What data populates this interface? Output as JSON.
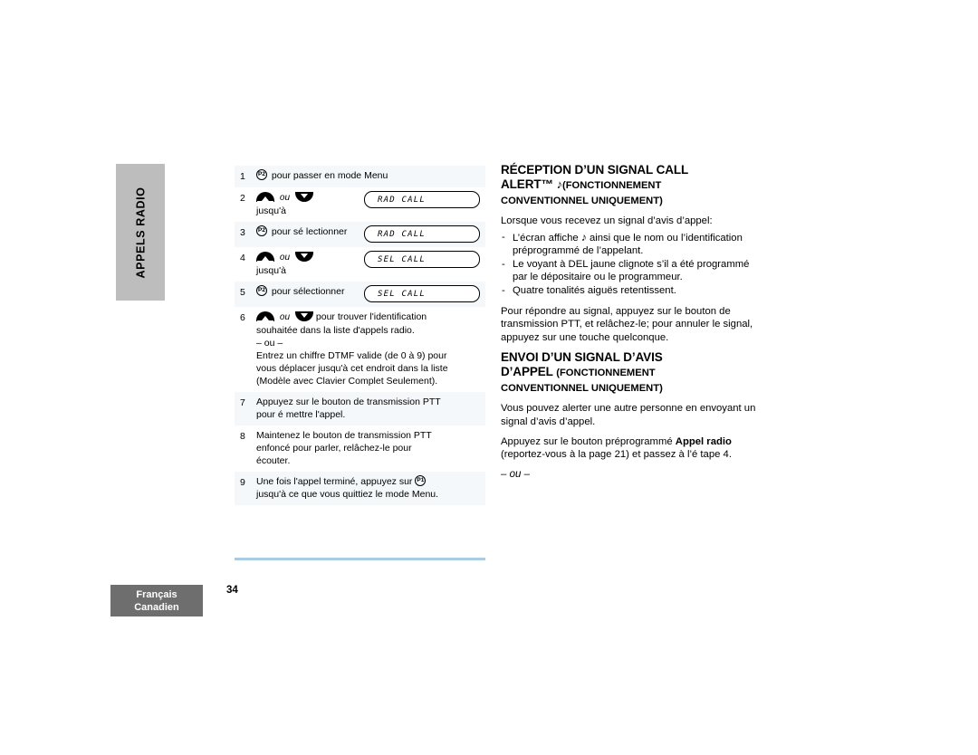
{
  "side_tab": {
    "label": "APPELS RADIO"
  },
  "steps": [
    {
      "num": "1",
      "shaded": true,
      "button": "P2",
      "text": "pour passer en mode Menu",
      "lcd": null,
      "layout": "inline"
    },
    {
      "num": "2",
      "shaded": false,
      "arrows": true,
      "ou": "ou",
      "text": "jusqu'à",
      "lcd": "RAD CALL",
      "layout": "arrows-lcd"
    },
    {
      "num": "3",
      "shaded": true,
      "button": "P2",
      "text": "pour sé lectionner",
      "lcd": "RAD CALL",
      "layout": "button-lcd"
    },
    {
      "num": "4",
      "shaded": false,
      "arrows": true,
      "ou": "ou",
      "text": "jusqu'à",
      "lcd": "SEL CALL",
      "layout": "arrows-lcd"
    },
    {
      "num": "5",
      "shaded": true,
      "button": "P2",
      "text": "pour sélectionner",
      "lcd": "SEL CALL",
      "layout": "button-lcd"
    },
    {
      "num": "6",
      "shaded": false,
      "arrows": true,
      "ou": "ou",
      "lead": "pour trouver l'identification",
      "lines": [
        "souhaitée dans la liste d'appels radio.",
        "– ou –",
        "Entrez un chiffre DTMF valide (de 0 à  9) pour",
        "vous déplacer jusqu'à cet endroit dans la liste",
        "(Modèle avec Clavier Complet Seulement)."
      ],
      "layout": "arrows-multiline"
    },
    {
      "num": "7",
      "shaded": true,
      "lines": [
        "Appuyez sur le bouton de transmission PTT",
        "pour é mettre l'appel."
      ],
      "layout": "text"
    },
    {
      "num": "8",
      "shaded": false,
      "lines": [
        "Maintenez le bouton de transmission PTT",
        "enfoncé  pour parler, relâchez-le pour",
        "écouter."
      ],
      "layout": "text"
    },
    {
      "num": "9",
      "shaded": true,
      "pre": "Une fois l'appel terminé, appuyez sur",
      "button": "P1",
      "post": "",
      "lines": [
        "jusqu'à ce que vous quittiez le mode Menu."
      ],
      "layout": "text-with-button"
    }
  ],
  "right": {
    "heading1_line1": "RÉCEPTION D’UN SIGNAL CALL",
    "heading1_line2a": "ALERT™",
    "heading1_note": "♪",
    "heading1_line2b": "(FONCTIONNEMENT",
    "heading1_line3": "CONVENTIONNEL UNIQUEMENT)",
    "intro": "Lorsque vous recevez un signal d’avis d’appel:",
    "bullets": [
      {
        "pre": "L’écran affiche",
        "glyph": "♪",
        "post": "ainsi que le nom ou l’identification préprogrammé  de l’appelant."
      },
      {
        "pre": "",
        "glyph": "",
        "post": "Le voyant à DEL jaune clignote s’il a été programmé  par le dépositaire ou le programmeur."
      },
      {
        "pre": "",
        "glyph": "",
        "post": "Quatre tonalités aiguës retentissent."
      }
    ],
    "para_respond": "Pour répondre au signal, appuyez sur le bouton de transmission PTT, et relâchez-le; pour annuler le signal, appuyez sur une touche quelconque.",
    "heading2_line1": "ENVOI D’UN SIGNAL D’AVIS",
    "heading2_line2a": "D’APPEL",
    "heading2_line2b": "(FONCTIONNEMENT",
    "heading2_line3": "CONVENTIONNEL UNIQUEMENT)",
    "para_send": "Vous pouvez alerter une autre personne en envoyant un signal d’avis d’appel.",
    "para_press_a": "Appuyez sur le bouton préprogrammé ",
    "para_press_bold1": "Appel radio",
    "para_press_b": " (reportez-vous à  la page 21) et passez à  l’é tape 4.",
    "ou_sep": "– ou –"
  },
  "footer": {
    "lang_line1": "Français",
    "lang_line2": "Canadien",
    "page_number": "34"
  }
}
